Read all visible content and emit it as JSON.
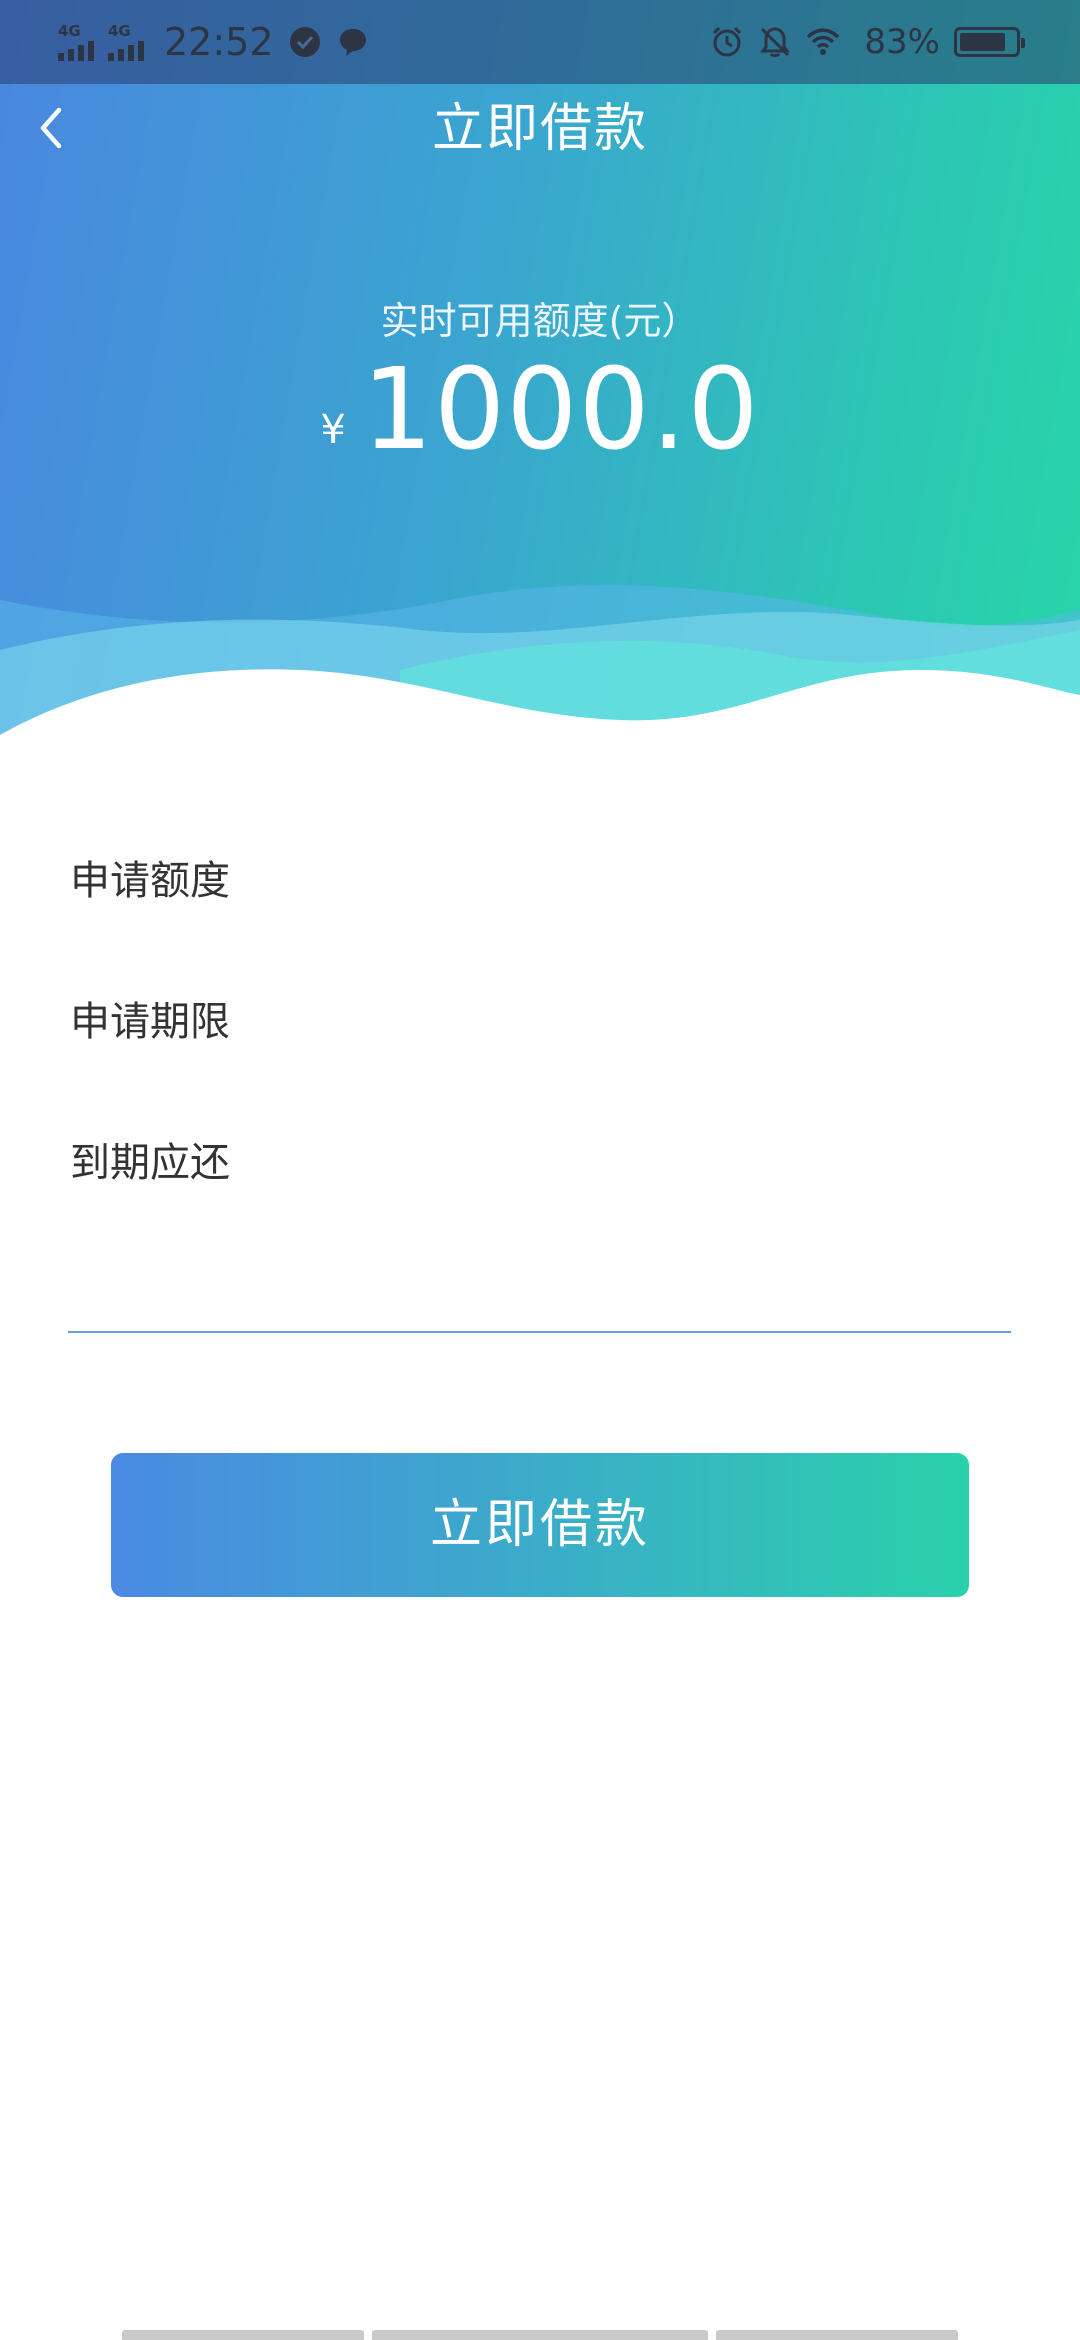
{
  "status_bar": {
    "network_1": "4G",
    "network_2": "4G",
    "time": "22:52",
    "battery_percent": "83%",
    "battery_level": 0.83,
    "icons": [
      "check-circle-icon",
      "message-bubble-icon",
      "alarm-icon",
      "bell-muted-icon",
      "wifi-icon",
      "battery-icon"
    ]
  },
  "nav": {
    "title": "立即借款",
    "back_icon": "chevron-left-icon"
  },
  "credit": {
    "label": "实时可用额度(元）",
    "currency": "¥",
    "amount": "1000.0"
  },
  "form": {
    "rows": [
      {
        "label": "申请额度"
      },
      {
        "label": "申请期限"
      },
      {
        "label": "到期应还"
      }
    ]
  },
  "submit": {
    "label": "立即借款"
  },
  "colors": {
    "gradient_start": "#4a87e0",
    "gradient_end": "#28d6a8",
    "divider": "#6b9fe3"
  }
}
